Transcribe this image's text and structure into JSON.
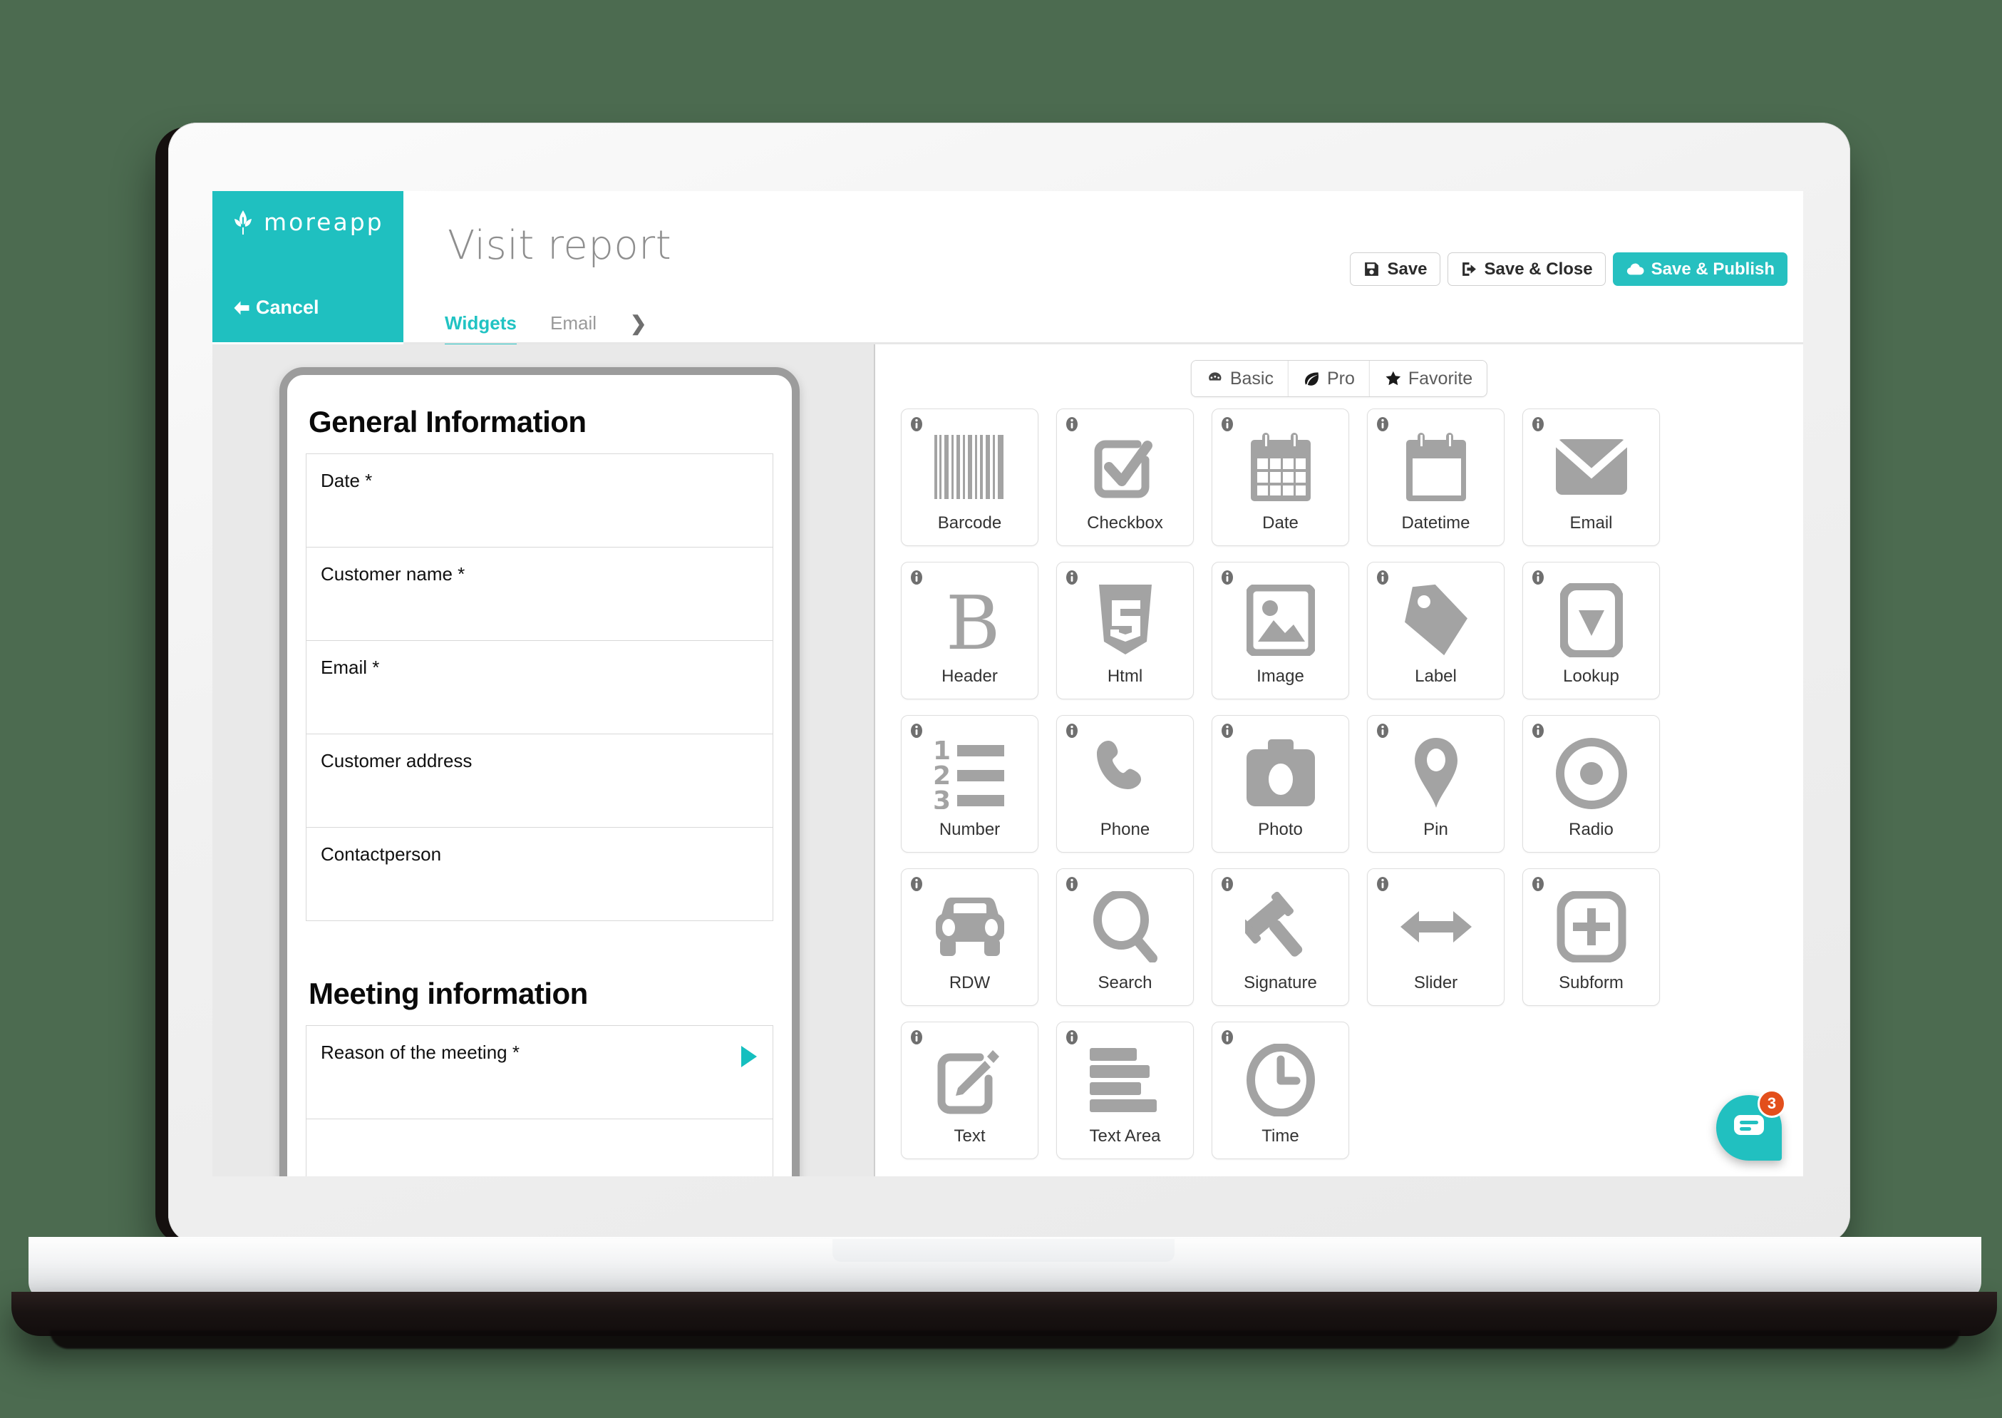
{
  "colors": {
    "brand_teal": "#1fc0c0",
    "accent_teal": "#21c3c3",
    "badge_orange": "#e34f1c",
    "page_background": "#4c6b50",
    "icon_gray": "#a3a3a3"
  },
  "brand": {
    "name": "moreapp",
    "logo_icon": "leaf-icon",
    "cancel_label": "Cancel",
    "cancel_icon": "arrow-left-icon"
  },
  "header": {
    "title": "Visit report",
    "tabs": [
      {
        "label": "Widgets",
        "active": true
      },
      {
        "label": "Email",
        "active": false
      }
    ],
    "more_tabs_icon": "chevron-right-icon",
    "actions": [
      {
        "label": "Save",
        "icon": "floppy-disk-icon",
        "primary": false
      },
      {
        "label": "Save & Close",
        "icon": "sign-out-icon",
        "primary": false
      },
      {
        "label": "Save & Publish",
        "icon": "cloud-upload-icon",
        "primary": true
      }
    ]
  },
  "form_preview": {
    "sections": [
      {
        "title": "General Information",
        "fields": [
          {
            "label": "Date *",
            "has_arrow": false
          },
          {
            "label": "Customer name *",
            "has_arrow": false
          },
          {
            "label": "Email *",
            "has_arrow": false
          },
          {
            "label": "Customer address",
            "has_arrow": false
          },
          {
            "label": "Contactperson",
            "has_arrow": false
          }
        ]
      },
      {
        "title": "Meeting information",
        "fields": [
          {
            "label": "Reason of the meeting *",
            "has_arrow": true
          },
          {
            "label": "",
            "has_arrow": false
          }
        ]
      }
    ]
  },
  "palette": {
    "filters": [
      {
        "label": "Basic",
        "icon": "palette-icon",
        "active": true
      },
      {
        "label": "Pro",
        "icon": "leaf-icon",
        "active": false
      },
      {
        "label": "Favorite",
        "icon": "star-icon",
        "active": false
      }
    ],
    "info_icon": "info-icon",
    "widgets": [
      {
        "label": "Barcode",
        "icon": "barcode-icon"
      },
      {
        "label": "Checkbox",
        "icon": "checkbox-icon"
      },
      {
        "label": "Date",
        "icon": "calendar-icon"
      },
      {
        "label": "Datetime",
        "icon": "calendar-blank-icon"
      },
      {
        "label": "Email",
        "icon": "envelope-icon"
      },
      {
        "label": "Header",
        "icon": "bold-b-icon"
      },
      {
        "label": "Html",
        "icon": "html5-icon"
      },
      {
        "label": "Image",
        "icon": "picture-icon"
      },
      {
        "label": "Label",
        "icon": "tag-icon"
      },
      {
        "label": "Lookup",
        "icon": "dropdown-icon"
      },
      {
        "label": "Number",
        "icon": "numbered-list-icon"
      },
      {
        "label": "Phone",
        "icon": "phone-icon"
      },
      {
        "label": "Photo",
        "icon": "camera-icon"
      },
      {
        "label": "Pin",
        "icon": "map-pin-icon"
      },
      {
        "label": "Radio",
        "icon": "radio-button-icon"
      },
      {
        "label": "RDW",
        "icon": "car-icon"
      },
      {
        "label": "Search",
        "icon": "magnifier-icon"
      },
      {
        "label": "Signature",
        "icon": "gavel-icon"
      },
      {
        "label": "Slider",
        "icon": "arrows-horizontal-icon"
      },
      {
        "label": "Subform",
        "icon": "plus-square-icon"
      },
      {
        "label": "Text",
        "icon": "pencil-square-icon"
      },
      {
        "label": "Text Area",
        "icon": "text-lines-icon"
      },
      {
        "label": "Time",
        "icon": "clock-icon"
      }
    ]
  },
  "chat_widget": {
    "icon": "chat-bubble-icon",
    "unread_count": "3"
  }
}
